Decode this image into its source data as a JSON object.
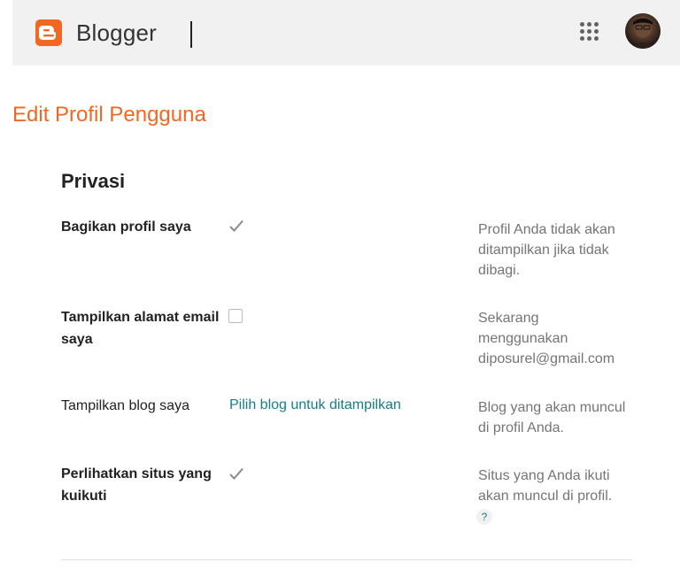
{
  "header": {
    "brand": "Blogger",
    "logo_icon": "blogger-logo-icon",
    "apps_icon": "apps-grid-icon",
    "avatar_icon": "user-avatar",
    "accent_color": "#f26722"
  },
  "page": {
    "title": "Edit Profil Pengguna"
  },
  "privacy": {
    "section_title": "Privasi",
    "rows": [
      {
        "label": "Bagikan profil saya",
        "control": "checkbox",
        "checked": true,
        "help": "Profil Anda tidak akan ditampilkan jika tidak dibagi."
      },
      {
        "label": "Tampilkan alamat email saya",
        "control": "checkbox",
        "checked": false,
        "help": "Sekarang menggunakan diposurel@gmail.com"
      },
      {
        "label": "Tampilkan blog saya",
        "control": "link",
        "link_text": "Pilih blog untuk ditampilkan",
        "help": "Blog yang akan muncul di profil Anda."
      },
      {
        "label": "Perlihatkan situs yang kuikuti",
        "control": "checkbox",
        "checked": true,
        "help": "Situs yang Anda ikuti akan muncul di profil.",
        "help_link": "?"
      }
    ]
  }
}
